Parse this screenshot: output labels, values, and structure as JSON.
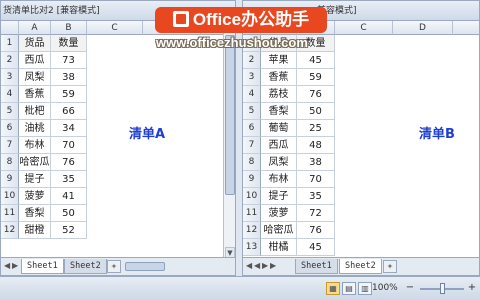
{
  "left": {
    "title": "货清单比对2 [兼容模式]",
    "columns": [
      "A",
      "B",
      "C",
      "D"
    ],
    "rows": [
      "1",
      "2",
      "3",
      "4",
      "5",
      "6",
      "7",
      "8",
      "9",
      "10",
      "11",
      "12"
    ],
    "header": [
      "货品",
      "数量"
    ],
    "items": [
      [
        "西瓜",
        "73"
      ],
      [
        "凤梨",
        "38"
      ],
      [
        "香蕉",
        "59"
      ],
      [
        "枇杷",
        "66"
      ],
      [
        "油桃",
        "34"
      ],
      [
        "布林",
        "70"
      ],
      [
        "哈密瓜",
        "76"
      ],
      [
        "提子",
        "35"
      ],
      [
        "菠萝",
        "41"
      ],
      [
        "香梨",
        "50"
      ],
      [
        "甜橙",
        "52"
      ]
    ],
    "label": "清单A",
    "tabs": [
      "Sheet1",
      "Sheet2"
    ]
  },
  "right": {
    "title": "兼容模式]",
    "columns": [
      "A",
      "B",
      "C",
      "D"
    ],
    "rows": [
      "1",
      "2",
      "3",
      "4",
      "5",
      "6",
      "7",
      "8",
      "9",
      "10",
      "11",
      "12",
      "13"
    ],
    "header": [
      "货品",
      "数量"
    ],
    "items": [
      [
        "苹果",
        "45"
      ],
      [
        "香蕉",
        "59"
      ],
      [
        "荔枝",
        "76"
      ],
      [
        "香梨",
        "50"
      ],
      [
        "葡萄",
        "25"
      ],
      [
        "西瓜",
        "48"
      ],
      [
        "凤梨",
        "38"
      ],
      [
        "布林",
        "70"
      ],
      [
        "提子",
        "35"
      ],
      [
        "菠萝",
        "72"
      ],
      [
        "哈密瓜",
        "76"
      ],
      [
        "柑橘",
        "45"
      ]
    ],
    "label": "清单B",
    "tabs": [
      "Sheet1",
      "Sheet2"
    ]
  },
  "status": {
    "zoom": "100%",
    "zoom_out": "−",
    "zoom_in": "+"
  },
  "watermark": {
    "brand": "Office办公助手",
    "url": "www.officezhushou.com"
  },
  "colors": {
    "label_blue": "#1f3fd0",
    "banner_red": "#e8471f",
    "active_view": "#f7dc8f"
  }
}
